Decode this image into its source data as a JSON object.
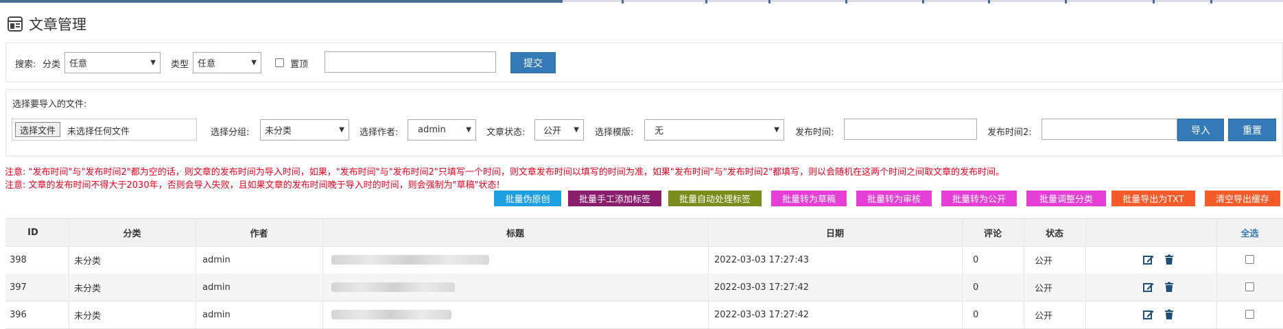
{
  "page_title": "文章管理",
  "search": {
    "label": "搜索:",
    "category_label": "分类",
    "category_value": "任意",
    "type_label": "类型",
    "type_value": "任意",
    "pin_label": "置顶",
    "keyword_value": "",
    "submit_label": "提交"
  },
  "import": {
    "file_label": "选择要导入的文件:",
    "file_button": "选择文件",
    "file_status": "未选择任何文件",
    "group_label": "选择分组:",
    "group_value": "未分类",
    "author_label": "选择作者:",
    "author_value": "admin",
    "status_label": "文章状态:",
    "status_value": "公开",
    "template_label": "选择模版:",
    "template_value": "无",
    "time1_label": "发布时间:",
    "time2_label": "发布时间2:",
    "import_button": "导入",
    "reset_button": "重置"
  },
  "notices": [
    "注意: \"发布时间\"与\"发布时间2\"都为空的话，则文章的发布时间为导入时间，如果，\"发布时间\"与\"发布时间2\"只填写一个时间，则文章发布时间以填写的时间为准，如果\"发布时间\"与\"发布时间2\"都填写，则以会随机在这两个时间之间取文章的发布时间。",
    "注意: 文章的发布时间不得大于2030年，否则会导入失败，且如果文章的发布时间晚于导入时的时间，则会强制为\"草稿\"状态!"
  ],
  "batch_buttons": [
    {
      "label": "批量伪原创",
      "color": "#1e9fe0"
    },
    {
      "label": "批量手工添加标签",
      "color": "#8b1d6e"
    },
    {
      "label": "批量自动处理标签",
      "color": "#7a8c1c"
    },
    {
      "label": "批量转为草稿",
      "color": "#e63fd8"
    },
    {
      "label": "批量转为审核",
      "color": "#e63fd8"
    },
    {
      "label": "批量转为公开",
      "color": "#e63fd8"
    },
    {
      "label": "批量调整分类",
      "color": "#e63fd8"
    },
    {
      "label": "批量导出为TXT",
      "color": "#f55a28"
    },
    {
      "label": "清空导出缓存",
      "color": "#f55a28"
    }
  ],
  "table": {
    "headers": [
      "ID",
      "分类",
      "作者",
      "标题",
      "日期",
      "评论",
      "状态",
      "",
      "全选"
    ],
    "rows": [
      {
        "id": "398",
        "category": "未分类",
        "author": "admin",
        "title": "",
        "date": "2022-03-03 17:27:43",
        "comments": "0",
        "status": "公开"
      },
      {
        "id": "397",
        "category": "未分类",
        "author": "admin",
        "title": "",
        "date": "2022-03-03 17:27:42",
        "comments": "0",
        "status": "公开"
      },
      {
        "id": "396",
        "category": "未分类",
        "author": "admin",
        "title": "",
        "date": "2022-03-03 17:27:42",
        "comments": "0",
        "status": "公开"
      }
    ]
  },
  "icons": {
    "title_icon": "article-icon",
    "edit": "edit-icon",
    "delete": "trash-icon"
  },
  "colors": {
    "primary": "#337ab7",
    "notice": "#e4001f",
    "topbar": "#4a6d97"
  }
}
